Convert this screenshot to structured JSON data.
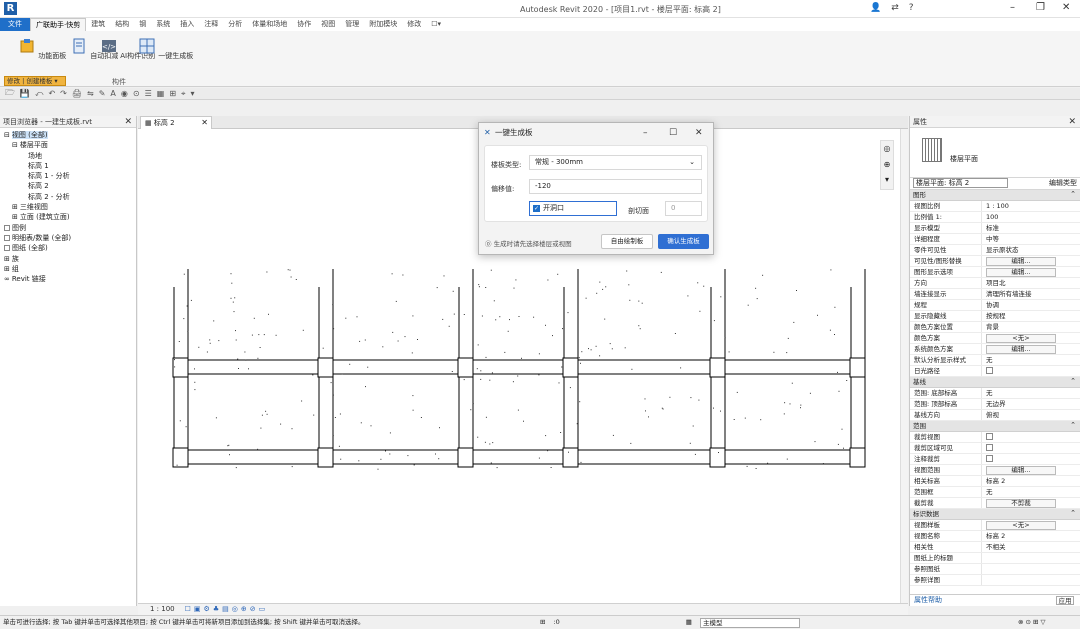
{
  "app": {
    "logo": "R",
    "title": "Autodesk Revit 2020 - [项目1.rvt - 楼层平面: 标高 2]"
  },
  "ribbon": {
    "tabs": [
      {
        "label": "文件",
        "style": "file"
      },
      {
        "label": "广联助手·快剪",
        "style": "active"
      },
      {
        "label": "建筑"
      },
      {
        "label": "结构"
      },
      {
        "label": "钢"
      },
      {
        "label": "系统"
      },
      {
        "label": "插入"
      },
      {
        "label": "注释"
      },
      {
        "label": "分析"
      },
      {
        "label": "体量和场地"
      },
      {
        "label": "协作"
      },
      {
        "label": "视图"
      },
      {
        "label": "管理"
      },
      {
        "label": "附加模块"
      },
      {
        "label": "修改"
      },
      {
        "label": "☐▾"
      }
    ],
    "buttons": [
      {
        "label": "功能面板"
      },
      {
        "label": "自动扣减"
      },
      {
        "label": "AI构件识别"
      },
      {
        "label": "一键生成板"
      }
    ],
    "panel_label": "构件",
    "tool_selector": "修改 | 创建楼板 ▾"
  },
  "qat": [
    "🗁",
    "💾",
    "⤺",
    "↶",
    "↷",
    "🖨",
    "⇋",
    "✎",
    "A",
    "◉",
    "⊙",
    "☰",
    "▦",
    "⊞",
    "⌖",
    "▾"
  ],
  "browser": {
    "title": "项目浏览器 - 一建生成板.rvt",
    "nodes": [
      {
        "label": "视图 (全部)",
        "indent": 0,
        "selected": true,
        "prefix": "⊟"
      },
      {
        "label": "楼层平面",
        "indent": 1,
        "prefix": "⊟"
      },
      {
        "label": "场地",
        "indent": 3
      },
      {
        "label": "标高 1",
        "indent": 3
      },
      {
        "label": "标高 1 - 分析",
        "indent": 3
      },
      {
        "label": "标高 2",
        "indent": 3
      },
      {
        "label": "标高 2 - 分析",
        "indent": 3
      },
      {
        "label": "三维视图",
        "indent": 1,
        "prefix": "⊞"
      },
      {
        "label": "立面 (建筑立面)",
        "indent": 1,
        "prefix": "⊞"
      },
      {
        "label": "图例",
        "indent": 0,
        "box": true
      },
      {
        "label": "明细表/数量 (全部)",
        "indent": 0,
        "box": true
      },
      {
        "label": "图纸 (全部)",
        "indent": 0,
        "box": true
      },
      {
        "label": "族",
        "indent": 0,
        "prefix": "⊞"
      },
      {
        "label": "组",
        "indent": 0,
        "prefix": "⊞"
      },
      {
        "label": "Revit 链接",
        "indent": 0,
        "prefix": "∞"
      }
    ]
  },
  "view": {
    "tab_label": "标高 2",
    "scale": "1 : 100",
    "controls": [
      "☐",
      "▣",
      "⚙",
      "♣",
      "▤",
      "◎",
      "⊕",
      "⊘",
      "▭"
    ]
  },
  "dialog": {
    "title": "一键生成板",
    "type_label": "楼板类型:",
    "type_value": "常规 - 300mm",
    "offset_label": "偏移值:",
    "offset_value": "-120",
    "checkbox_label": "开洞口",
    "extra_label": "剖切面",
    "extra_value": "0",
    "footer_text": "⓪ 生成时请先选择楼层或视图",
    "btn_secondary": "自由绘制板",
    "btn_primary": "确认生成板"
  },
  "properties": {
    "title": "属性",
    "type_name": "楼层平面",
    "filter": "楼层平面: 标高 2",
    "edit_type": "编辑类型",
    "rows": [
      {
        "section": "图形"
      },
      {
        "k": "视图比例",
        "v": "1 : 100"
      },
      {
        "k": "比例值 1:",
        "v": "100"
      },
      {
        "k": "显示模型",
        "v": "标准"
      },
      {
        "k": "详细程度",
        "v": "中等"
      },
      {
        "k": "零件可见性",
        "v": "显示原状态"
      },
      {
        "k": "可见性/图形替换",
        "v": "编辑...",
        "kind": "btn"
      },
      {
        "k": "图形显示选项",
        "v": "编辑...",
        "kind": "btn"
      },
      {
        "k": "方向",
        "v": "项目北"
      },
      {
        "k": "墙连接显示",
        "v": "清理所有墙连接"
      },
      {
        "k": "规程",
        "v": "协调"
      },
      {
        "k": "显示隐藏线",
        "v": "按规程"
      },
      {
        "k": "颜色方案位置",
        "v": "背景"
      },
      {
        "k": "颜色方案",
        "v": "<无>",
        "kind": "btn"
      },
      {
        "k": "系统颜色方案",
        "v": "编辑...",
        "kind": "btn"
      },
      {
        "k": "默认分析显示样式",
        "v": "无"
      },
      {
        "k": "日光路径",
        "v": "",
        "kind": "chk"
      },
      {
        "section": "基线"
      },
      {
        "k": "范围: 底部标高",
        "v": "无"
      },
      {
        "k": "范围: 顶部标高",
        "v": "无边界"
      },
      {
        "k": "基线方向",
        "v": "俯视"
      },
      {
        "section": "范围"
      },
      {
        "k": "裁剪视图",
        "v": "",
        "kind": "chk"
      },
      {
        "k": "裁剪区域可见",
        "v": "",
        "kind": "chk"
      },
      {
        "k": "注释裁剪",
        "v": "",
        "kind": "chk"
      },
      {
        "k": "视图范围",
        "v": "编辑...",
        "kind": "btn"
      },
      {
        "k": "相关标高",
        "v": "标高 2"
      },
      {
        "k": "范围框",
        "v": "无"
      },
      {
        "k": "截剪裁",
        "v": "不剪裁",
        "kind": "btn"
      },
      {
        "section": "标识数据"
      },
      {
        "k": "视图样板",
        "v": "<无>",
        "kind": "btn"
      },
      {
        "k": "视图名称",
        "v": "标高 2"
      },
      {
        "k": "相关性",
        "v": "不相关"
      },
      {
        "k": "图纸上的标题",
        "v": ""
      },
      {
        "k": "参照图纸",
        "v": ""
      },
      {
        "k": "参照详图",
        "v": ""
      }
    ],
    "help": "属性帮助",
    "apply": "应用"
  },
  "status": {
    "message": "单击可进行选择; 按 Tab 键并单击可选择其他项目; 按 Ctrl 键并单击可将新项目添加到选择集; 按 Shift 键并单击可取消选择。",
    "level_combo": "主模型",
    "zero": ":0"
  }
}
